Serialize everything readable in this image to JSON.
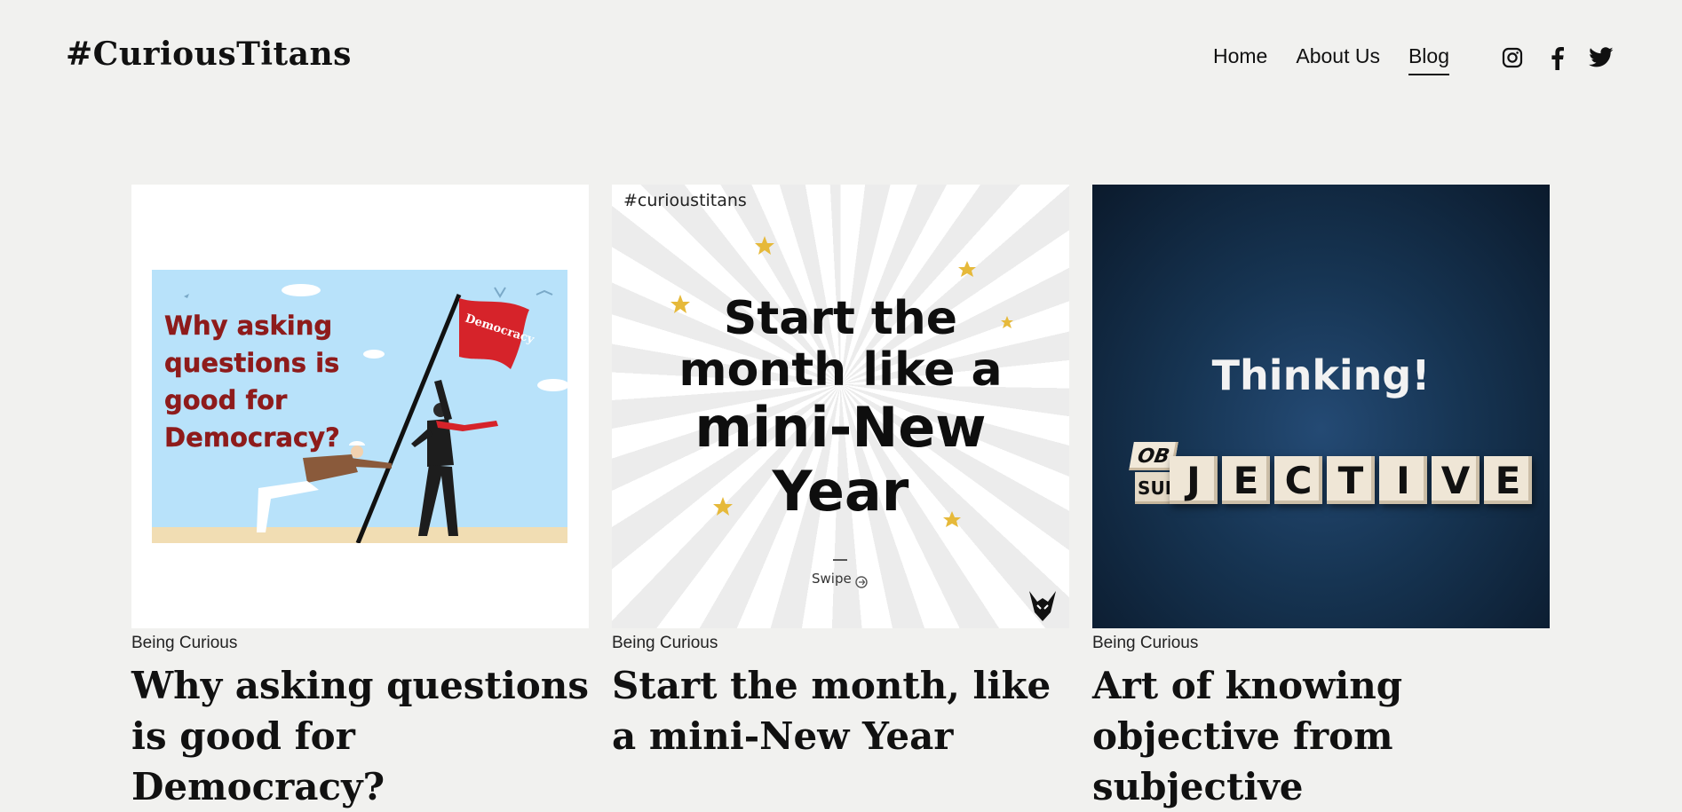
{
  "site": {
    "logo": "#CuriousTitans"
  },
  "nav": {
    "items": [
      {
        "label": "Home",
        "active": false
      },
      {
        "label": "About Us",
        "active": false
      },
      {
        "label": "Blog",
        "active": true
      }
    ]
  },
  "social": {
    "icons": [
      "instagram-icon",
      "facebook-icon",
      "twitter-icon"
    ]
  },
  "posts": [
    {
      "category": "Being Curious",
      "title": "Why asking questions is good for Democracy?",
      "image": {
        "headline_lines": [
          "Why asking",
          "questions is",
          "good for",
          "Democracy?"
        ],
        "flag_text": "Democracy"
      }
    },
    {
      "category": "Being Curious",
      "title": "Start the month, like a mini-New Year",
      "image": {
        "hashtag": "#curioustitans",
        "line1": "Start the",
        "line2": "month like a",
        "line3": "mini-New",
        "line4": "Year",
        "swipe": "Swipe"
      }
    },
    {
      "category": "Being Curious",
      "title": "Art of knowing objective from subjective",
      "image": {
        "headline": "Thinking!",
        "cube_top": "OB",
        "cube_side": "SUB",
        "letters": [
          "J",
          "E",
          "C",
          "T",
          "I",
          "V",
          "E"
        ]
      }
    }
  ],
  "colors": {
    "background": "#f1f1ef",
    "text": "#111111",
    "democracy_red": "#8e1b1b",
    "sky": "#b8e2fa",
    "dark_blue": "#163452"
  }
}
